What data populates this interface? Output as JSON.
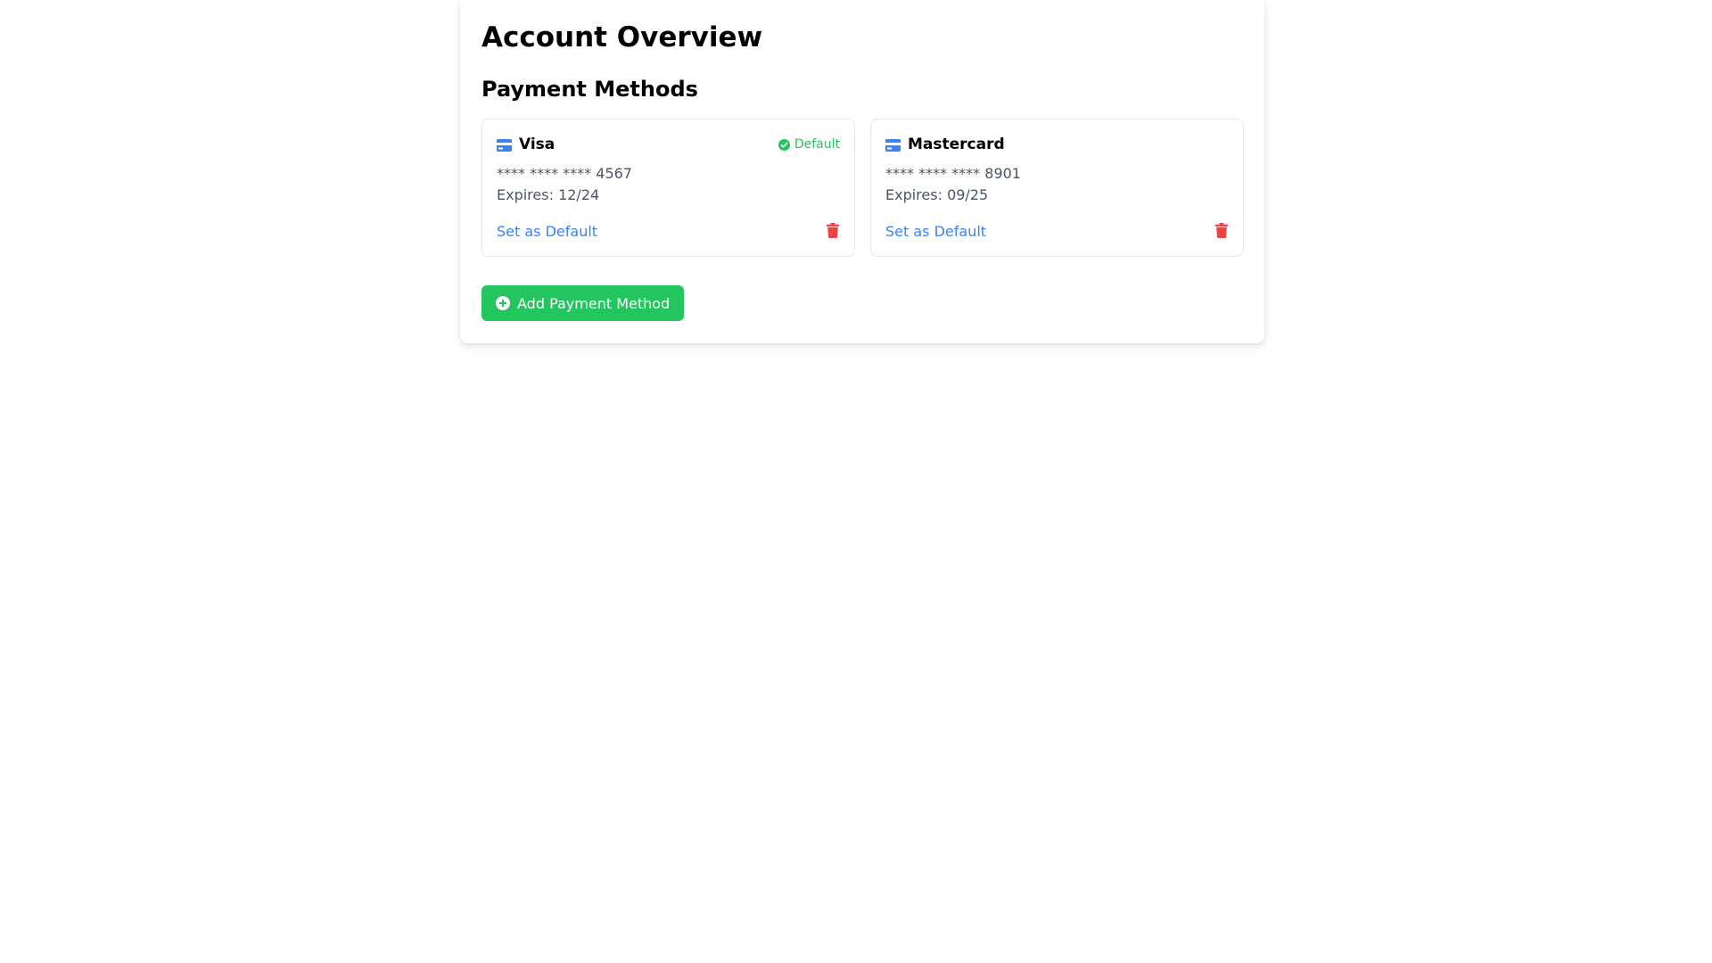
{
  "page": {
    "title": "Account Overview"
  },
  "payment": {
    "section_title": "Payment Methods",
    "cards": [
      {
        "brand": "Visa",
        "number": "**** **** **** 4567",
        "expiry": "Expires: 12/24",
        "is_default": true,
        "default_label": "Default",
        "action_label": "Set as Default",
        "icon": "credit-card-icon"
      },
      {
        "brand": "Mastercard",
        "number": "**** **** **** 8901",
        "expiry": "Expires: 09/25",
        "is_default": false,
        "action_label": "Set as Default",
        "icon": "credit-card-icon"
      }
    ],
    "add_label": "Add Payment Method"
  },
  "colors": {
    "accent_blue": "#3b82f6",
    "success_green": "#22c55e",
    "danger_red": "#ef4444",
    "muted_text": "#4b5563"
  }
}
